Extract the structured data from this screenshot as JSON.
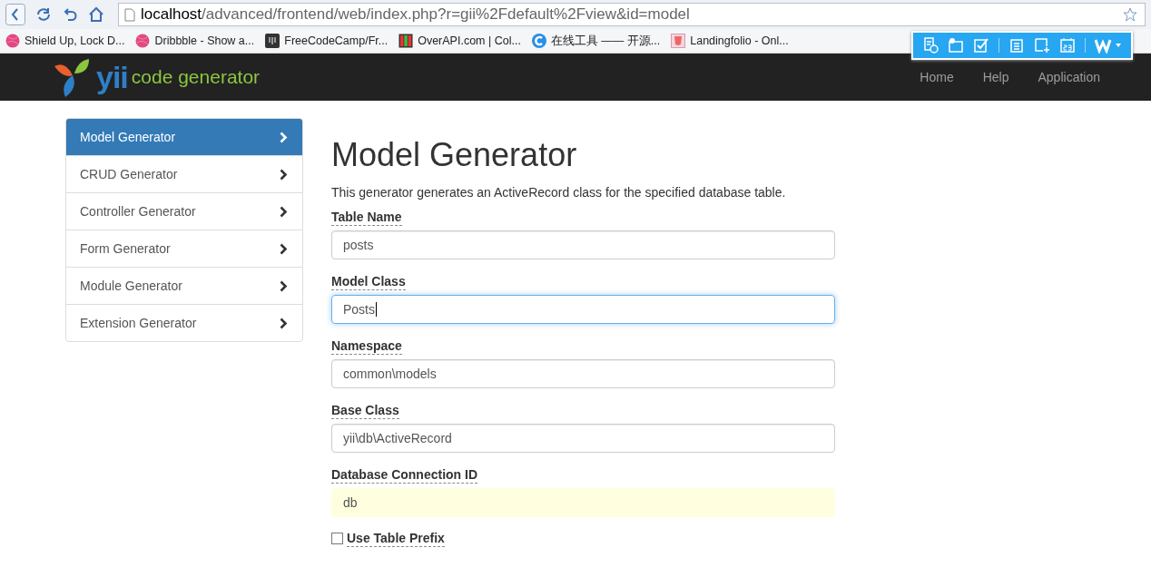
{
  "browser": {
    "url": {
      "host": "localhost",
      "path": "/advanced/frontend/web/index.php?r=gii%2Fdefault%2Fview&id=model"
    },
    "bookmarks": [
      {
        "label": "Shield Up, Lock D...",
        "kind": "dribbble"
      },
      {
        "label": "Dribbble - Show a...",
        "kind": "dribbble"
      },
      {
        "label": "FreeCodeCamp/Fr...",
        "kind": "dark"
      },
      {
        "label": "OverAPI.com | Col...",
        "kind": "bars"
      },
      {
        "label": "在线工具 —— 开源...",
        "kind": "c"
      },
      {
        "label": "Landingfolio - Onl...",
        "kind": "html"
      }
    ]
  },
  "navbar": {
    "logo": {
      "mark": "yii",
      "text": "code generator"
    },
    "links": [
      "Home",
      "Help",
      "Application"
    ]
  },
  "sidebar": {
    "items": [
      {
        "label": "Model Generator",
        "selected": true
      },
      {
        "label": "CRUD Generator",
        "selected": false
      },
      {
        "label": "Controller Generator",
        "selected": false
      },
      {
        "label": "Form Generator",
        "selected": false
      },
      {
        "label": "Module Generator",
        "selected": false
      },
      {
        "label": "Extension Generator",
        "selected": false
      }
    ]
  },
  "main": {
    "title": "Model Generator",
    "description": "This generator generates an ActiveRecord class for the specified database table.",
    "fields": [
      {
        "kind": "text",
        "label": "Table Name",
        "value": "posts",
        "focused": false,
        "highlighted": false
      },
      {
        "kind": "text",
        "label": "Model Class",
        "value": "Posts",
        "focused": true,
        "highlighted": false
      },
      {
        "kind": "text",
        "label": "Namespace",
        "value": "common\\models",
        "focused": false,
        "highlighted": false
      },
      {
        "kind": "text",
        "label": "Base Class",
        "value": "yii\\db\\ActiveRecord",
        "focused": false,
        "highlighted": false
      },
      {
        "kind": "text",
        "label": "Database Connection ID",
        "value": "db",
        "focused": false,
        "highlighted": true
      },
      {
        "kind": "checkbox",
        "label": "Use Table Prefix",
        "checked": false
      }
    ]
  }
}
